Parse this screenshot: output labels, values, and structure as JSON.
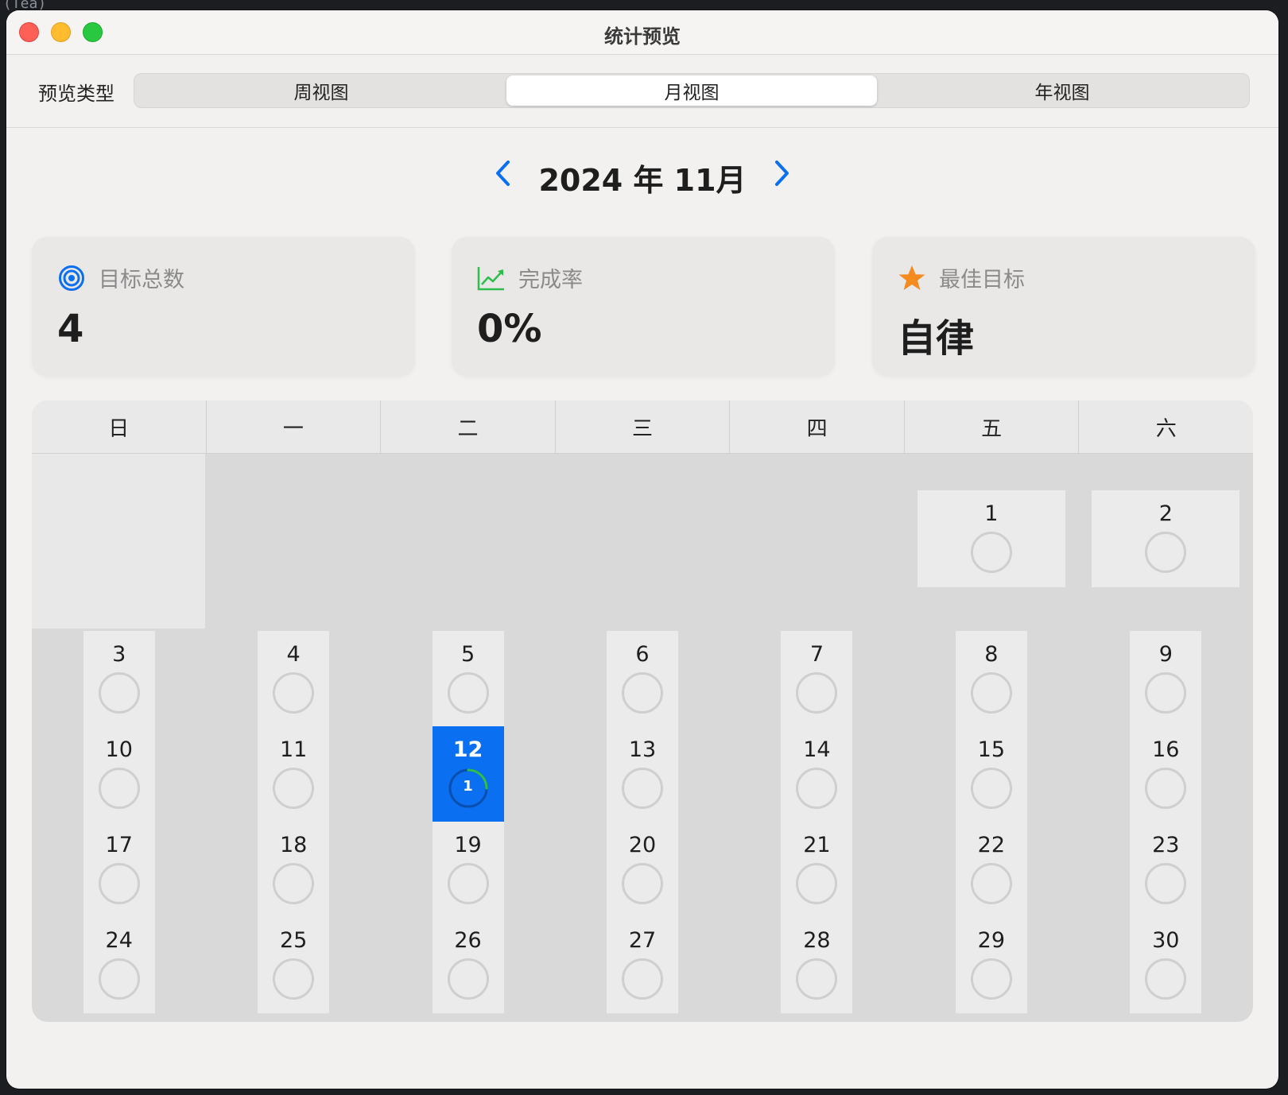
{
  "background": {
    "snippet": "(Tea)"
  },
  "window": {
    "title": "统计预览"
  },
  "toolbar": {
    "label": "预览类型",
    "segments": [
      {
        "label": "周视图",
        "active": false
      },
      {
        "label": "月视图",
        "active": true
      },
      {
        "label": "年视图",
        "active": false
      }
    ]
  },
  "nav": {
    "month_title": "2024 年 11月",
    "prev_icon": "chevron-left-icon",
    "next_icon": "chevron-right-icon",
    "accent": "#0a6ff0"
  },
  "cards": [
    {
      "icon": "target-icon",
      "label": "目标总数",
      "value": "4",
      "icon_color": "#0a6ff0"
    },
    {
      "icon": "chart-line-icon",
      "label": "完成率",
      "value": "0%",
      "icon_color": "#2fbe4b"
    },
    {
      "icon": "star-icon",
      "label": "最佳目标",
      "value": "自律",
      "icon_color": "#f58a1f"
    }
  ],
  "calendar": {
    "weekdays": [
      "日",
      "一",
      "二",
      "三",
      "四",
      "五",
      "六"
    ],
    "first_row": [
      {
        "day": "1",
        "col": 5
      },
      {
        "day": "2",
        "col": 6
      }
    ],
    "rows": [
      [
        "3",
        "4",
        "5",
        "6",
        "7",
        "8",
        "9"
      ],
      [
        "10",
        "11",
        "12",
        "13",
        "14",
        "15",
        "16"
      ],
      [
        "17",
        "18",
        "19",
        "20",
        "21",
        "22",
        "23"
      ],
      [
        "24",
        "25",
        "26",
        "27",
        "28",
        "29",
        "30"
      ]
    ],
    "today": {
      "day": "12",
      "count": "1",
      "progress": 0.25,
      "progress_color": "#2fbe4b"
    }
  }
}
